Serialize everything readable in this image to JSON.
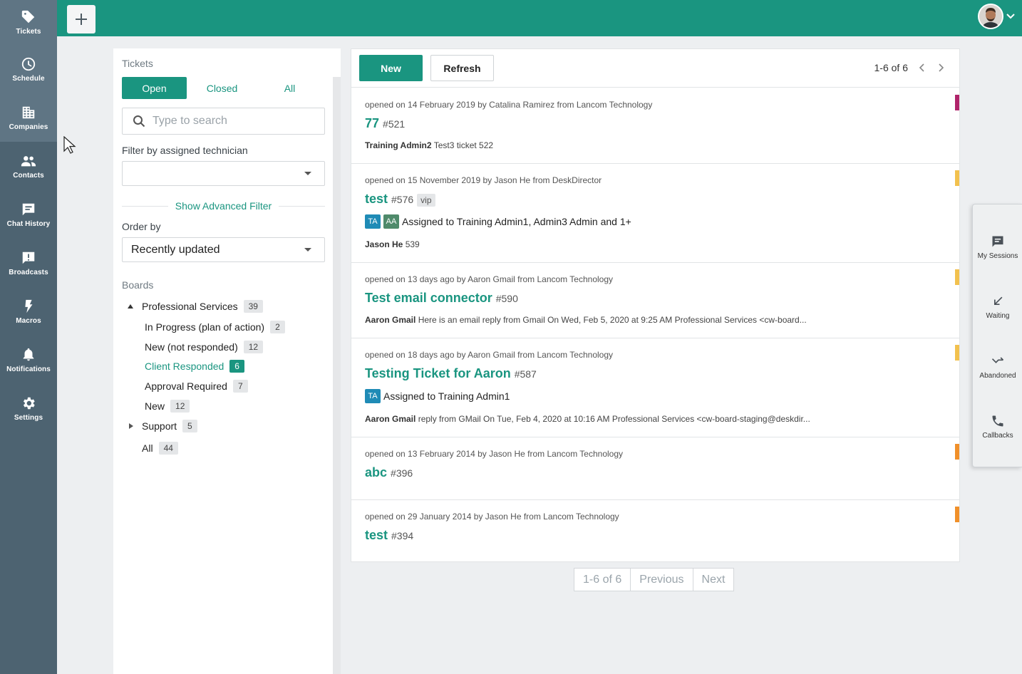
{
  "nav": {
    "items": [
      {
        "label": "Tickets",
        "icon": "tag-icon"
      },
      {
        "label": "Schedule",
        "icon": "clock-icon"
      },
      {
        "label": "Companies",
        "icon": "building-icon"
      },
      {
        "label": "Contacts",
        "icon": "people-icon"
      },
      {
        "label": "Chat History",
        "icon": "chat-icon"
      },
      {
        "label": "Broadcasts",
        "icon": "broadcast-icon"
      },
      {
        "label": "Macros",
        "icon": "bolt-icon"
      },
      {
        "label": "Notifications",
        "icon": "bell-icon"
      },
      {
        "label": "Settings",
        "icon": "gear-icon"
      }
    ]
  },
  "filter": {
    "title": "Tickets",
    "tabs": [
      "Open",
      "Closed",
      "All"
    ],
    "search_placeholder": "Type to search",
    "technician_label": "Filter by assigned technician",
    "technician_value": "",
    "advanced": "Show Advanced Filter",
    "order_label": "Order by",
    "order_value": "Recently updated",
    "boards_label": "Boards",
    "boards": {
      "professional": {
        "label": "Professional Services",
        "count": "39"
      },
      "in_progress": {
        "label": "In Progress (plan of action)",
        "count": "2"
      },
      "new_not_responded": {
        "label": "New (not responded)",
        "count": "12"
      },
      "client_responded": {
        "label": "Client Responded",
        "count": "6"
      },
      "approval": {
        "label": "Approval Required",
        "count": "7"
      },
      "new": {
        "label": "New",
        "count": "12"
      },
      "support": {
        "label": "Support",
        "count": "5"
      },
      "all": {
        "label": "All",
        "count": "44"
      }
    }
  },
  "toolbar": {
    "new_label": "New",
    "refresh_label": "Refresh",
    "range": "1-6 of 6"
  },
  "tickets": [
    {
      "meta": "opened on 14 February 2019 by Catalina Ramirez from Lancom Technology",
      "title": "77",
      "num": "#521",
      "author": "Training Admin2",
      "text": "Test3 ticket 522",
      "color": "#b0246a"
    },
    {
      "meta": "opened on 15 November 2019 by Jason He from DeskDirector",
      "title": "test",
      "num": "#576",
      "vip": "vip",
      "assign": "Assigned to Training Admin1, Admin3 Admin and 1+",
      "author": "Jason He",
      "text": "539",
      "color": "#f2c14e"
    },
    {
      "meta": "opened on 13 days ago by Aaron Gmail from Lancom Technology",
      "title": "Test email connector",
      "num": "#590",
      "author": "Aaron Gmail",
      "text": "Here is an email reply from Gmail On Wed, Feb 5, 2020 at 9:25 AM Professional Services <cw-board...",
      "color": "#f2c14e"
    },
    {
      "meta": "opened on 18 days ago by Aaron Gmail from Lancom Technology",
      "title": "Testing Ticket for Aaron",
      "num": "#587",
      "assign": "Assigned to Training Admin1",
      "author": "Aaron Gmail",
      "text": "reply from GMail On Tue, Feb 4, 2020 at 10:16 AM Professional Services <cw-board-staging@deskdir...",
      "color": "#f2c14e"
    },
    {
      "meta": "opened on 13 February 2014 by Jason He from Lancom Technology",
      "title": "abc",
      "num": "#396",
      "color": "#f0902a"
    },
    {
      "meta": "opened on 29 January 2014 by Jason He from Lancom Technology",
      "title": "test",
      "num": "#394",
      "color": "#f0902a"
    }
  ],
  "tags": {
    "ta": "TA",
    "aa": "AA"
  },
  "pager": {
    "range": "1-6 of 6",
    "previous": "Previous",
    "next": "Next"
  },
  "float": {
    "sessions": "My Sessions",
    "waiting": "Waiting",
    "abandoned": "Abandoned",
    "callbacks": "Callbacks"
  }
}
